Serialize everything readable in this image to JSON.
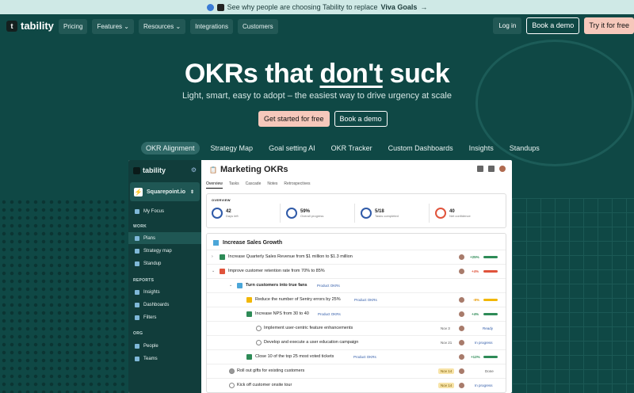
{
  "banner": {
    "text": "See why people are choosing Tability to replace",
    "emph": "Viva Goals",
    "arrow": "→"
  },
  "nav": {
    "logo": "tability",
    "links": [
      "Pricing",
      "Features",
      "Resources",
      "Integrations",
      "Customers"
    ],
    "login": "Log in",
    "book_demo": "Book a demo",
    "try_free": "Try it for free"
  },
  "hero": {
    "title_pre": "OKRs that",
    "title_emph": "don't",
    "title_post": "suck",
    "subtitle": "Light, smart, easy to adopt – the easiest way to drive urgency at scale",
    "cta_primary": "Get started for free",
    "cta_secondary": "Book a demo"
  },
  "feature_tabs": [
    "OKR Alignment",
    "Strategy Map",
    "Goal setting AI",
    "OKR Tracker",
    "Custom Dashboards",
    "Insights",
    "Standups"
  ],
  "app": {
    "sidebar": {
      "logo": "tability",
      "workspace": "Squarepoint.io",
      "my_focus": "My Focus",
      "work_header": "WORK",
      "work_items": [
        "Plans",
        "Strategy map",
        "Standup"
      ],
      "reports_header": "REPORTS",
      "reports_items": [
        "Insights",
        "Dashboards",
        "Filters"
      ],
      "org_header": "ORG",
      "org_items": [
        "People",
        "Teams"
      ]
    },
    "plan_title": "Marketing OKRs",
    "tabs": [
      "Overview",
      "Tasks",
      "Cascade",
      "Notes",
      "Retrospectives"
    ],
    "overview": {
      "label": "OVERVIEW",
      "stats": [
        {
          "num": "42",
          "cap": "Days left"
        },
        {
          "num": "59%",
          "cap": "Overall progress"
        },
        {
          "num": "5/18",
          "cap": "Tasks completed"
        },
        {
          "num": "40",
          "cap": "Net confidence"
        }
      ]
    },
    "goal_title": "Increase Sales Growth",
    "rows": [
      {
        "text": "Increase Quarterly Sales Revenue from $1 million to $1.3 million",
        "pct": "+25%"
      },
      {
        "text": "Improve customer retention rate from 70% to 85%",
        "pct": "+4%"
      },
      {
        "text": "Turn customers into true fans",
        "tag": "Product OKRs"
      },
      {
        "text": "Reduce the number of Sentry errors by 25%",
        "tag": "Product OKRs",
        "pct": "-8%"
      },
      {
        "text": "Increase NPS from 30 to 40",
        "tag": "Product OKRs",
        "pct": "+4%"
      },
      {
        "text": "Implement user-centric feature enhancements",
        "date": "Nov 3",
        "status": "Ready"
      },
      {
        "text": "Develop and execute a user education campaign",
        "date": "Nov 21",
        "status": "In progress"
      },
      {
        "text": "Close 10 of the top 25 most voted tickets",
        "tag": "Product OKRs",
        "pct": "+12%"
      },
      {
        "text": "Roll out gifts for existing customers",
        "date": "Nov 14",
        "status": "Done"
      },
      {
        "text": "Kick off customer onsite tour",
        "date": "Nov 14",
        "status": "In progress"
      }
    ]
  },
  "colors": {
    "bg": "#0f4845",
    "accent": "#f6c8bb",
    "green": "#2e8b57",
    "red": "#e0533b",
    "yellow": "#f2b705"
  }
}
